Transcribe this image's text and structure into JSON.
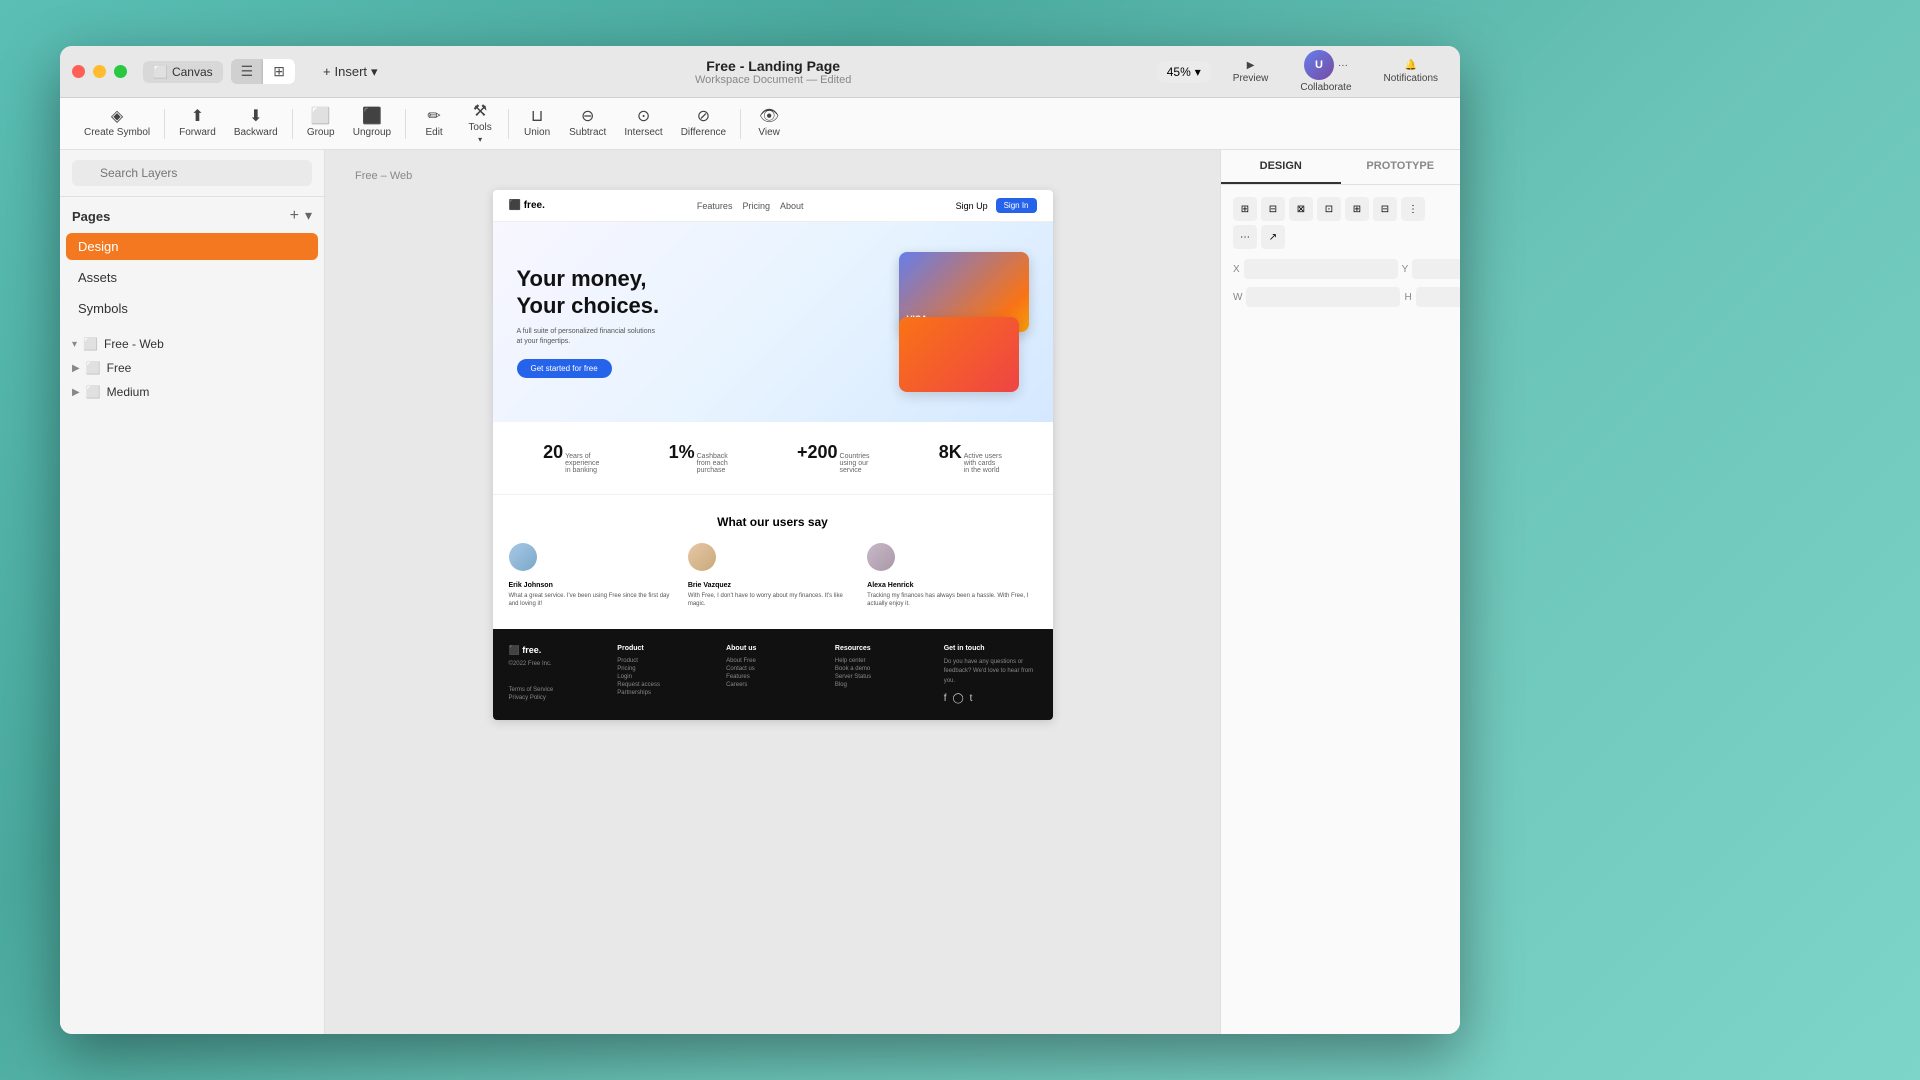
{
  "window": {
    "title": "Free - Landing Page",
    "subtitle": "Workspace Document — Edited"
  },
  "titlebar": {
    "canvas_label": "Canvas",
    "view_grid": "⊞"
  },
  "toolbar": {
    "insert_label": "Insert",
    "create_symbol_label": "Create Symbol",
    "forward_label": "Forward",
    "backward_label": "Backward",
    "group_label": "Group",
    "ungroup_label": "Ungroup",
    "edit_label": "Edit",
    "tools_label": "Tools",
    "union_label": "Union",
    "subtract_label": "Subtract",
    "intersect_label": "Intersect",
    "difference_label": "Difference",
    "view_label": "View",
    "zoom_value": "45%",
    "preview_label": "Preview",
    "collaborate_label": "Collaborate",
    "notifications_label": "Notifications"
  },
  "sidebar": {
    "search_placeholder": "Search Layers",
    "pages_label": "Pages",
    "pages": [
      {
        "name": "Design",
        "active": true
      },
      {
        "name": "Assets",
        "active": false
      },
      {
        "name": "Symbols",
        "active": false
      }
    ],
    "layers": [
      {
        "name": "Free - Web",
        "expanded": true,
        "level": 0
      },
      {
        "name": "Free",
        "expanded": false,
        "level": 0
      },
      {
        "name": "Medium",
        "expanded": false,
        "level": 0
      }
    ]
  },
  "canvas": {
    "label": "Free – Web"
  },
  "webpage": {
    "nav": {
      "logo": "⬛ free.",
      "links": [
        "Features",
        "Pricing",
        "About"
      ],
      "signup": "Sign Up",
      "signin": "Sign In"
    },
    "hero": {
      "headline1": "Your money,",
      "headline2": "Your choices.",
      "subtext": "A full suite of personalized financial solutions\nat your fingertips.",
      "cta": "Get started for free"
    },
    "stats": [
      {
        "num": "20",
        "label": "Years of\nexperience\nin banking"
      },
      {
        "num": "1%",
        "label": "Cashback\nfrom each\npurchase"
      },
      {
        "num": "+200",
        "label": "Countries\nusing our\nservice"
      },
      {
        "num": "8K",
        "label": "Active users\nwith cards\nin the world"
      }
    ],
    "testimonials": {
      "title": "What our users say",
      "items": [
        {
          "name": "Erik Johnson",
          "text": "What a great service. I've been using Free since the first day and loving it!",
          "avatar_color": "#a0c4ff"
        },
        {
          "name": "Brie Vazquez",
          "text": "With Free, I don't have to worry about my finances. It's like magic.",
          "avatar_color": "#ffd6a5"
        },
        {
          "name": "Alexa Henrick",
          "text": "Tracking my finances has always been a hassle. With Free, I actually enjoy it.",
          "avatar_color": "#c9b1bd"
        }
      ]
    },
    "footer": {
      "logo": "⬛ free.",
      "copyright": "©2022 Free Inc.",
      "links1": [
        "Terms of Service",
        "Privacy Policy"
      ],
      "columns": [
        {
          "title": "Product",
          "links": [
            "Product",
            "Pricing",
            "Login",
            "Request access",
            "Partnerships"
          ]
        },
        {
          "title": "About us",
          "links": [
            "About Free",
            "Contact us",
            "Features",
            "Careers"
          ]
        },
        {
          "title": "Resources",
          "links": [
            "Help center",
            "Book a demo",
            "Server Status",
            "Blog"
          ]
        },
        {
          "title": "Get in touch",
          "text": "Do you have any questions or feedback? We'd love to hear from you."
        }
      ]
    }
  },
  "right_panel": {
    "tabs": [
      "DESIGN",
      "PROTOTYPE"
    ],
    "active_tab": "DESIGN",
    "props": {
      "x_label": "X",
      "y_label": "Y",
      "w_label": "W",
      "h_label": "H"
    }
  }
}
